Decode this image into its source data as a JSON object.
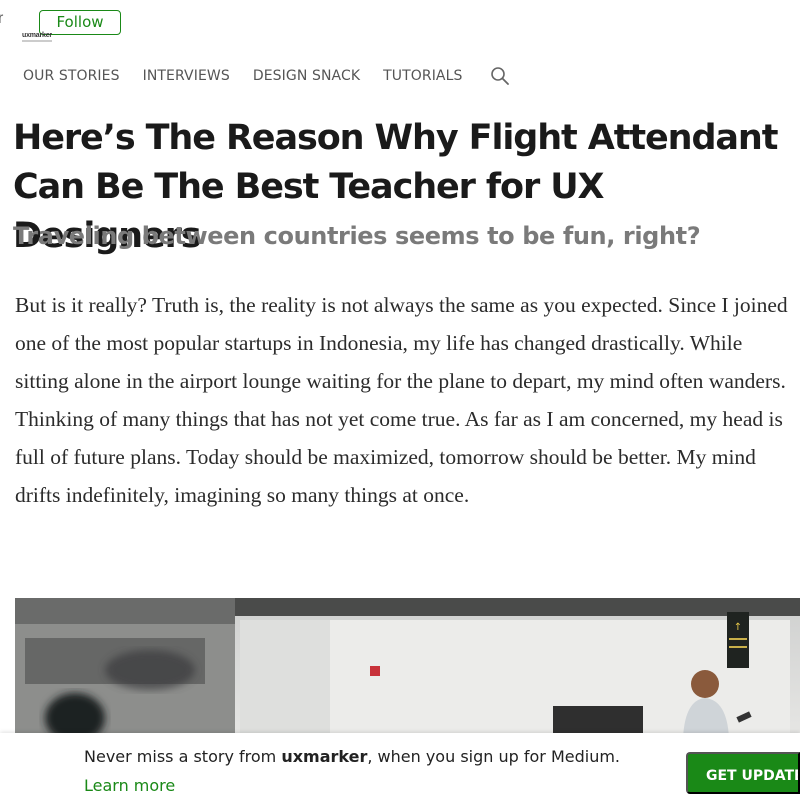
{
  "header": {
    "top_fragment": "r",
    "follow_label": "Follow"
  },
  "nav": {
    "items": [
      "OUR STORIES",
      "INTERVIEWS",
      "DESIGN SNACK",
      "TUTORIALS"
    ],
    "search_icon": "search-icon"
  },
  "article": {
    "title": "Here’s The Reason Why Flight Attendant Can Be The Best Teacher for UX Designers",
    "subtitle": "Traveling between countries seems to be fun, right?",
    "body": "But is it really? Truth is, the reality is not always the same as you expected. Since I joined one of the most popular startups in Indonesia, my life has changed drastically. While sitting alone in the airport lounge waiting for the plane to depart, my mind often wanders. Thinking of many things that has not yet come true. As far as I am concerned, my head is full of future plans. Today should be maximized, tomorrow should be better. My mind drifts indefinitely, imagining so many things at once.",
    "hero_sign": "↑"
  },
  "footer": {
    "logo_text": "uxmarker",
    "promo_prefix": "Never miss a story from ",
    "publication": "uxmarker",
    "promo_suffix": ", when you sign up for Medium.",
    "learn_more": "Learn more",
    "cta_label": "GET UPDATES"
  },
  "colors": {
    "accent": "#1a8917",
    "title": "#1a1a1a",
    "subtitle": "#7a7a7a",
    "nav": "#555555"
  }
}
